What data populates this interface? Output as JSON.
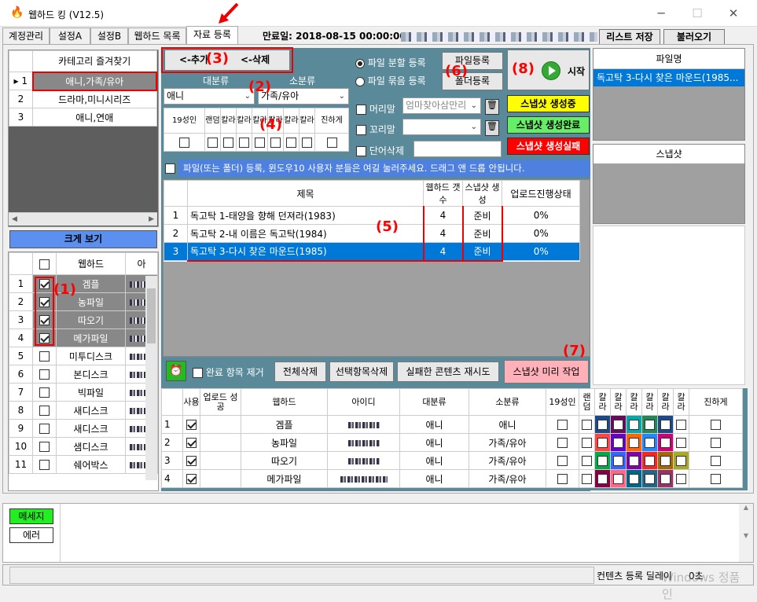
{
  "window": {
    "title": "웹하드 킹 (V12.5)",
    "minimize": "─",
    "maximize": "☐",
    "close": "✕"
  },
  "tabs": [
    "계정관리",
    "설정A",
    "설정B",
    "웹하드 목록",
    "자료 등록"
  ],
  "expiry": "만료일: 2018-08-15 00:00:00",
  "toolbar": {
    "save_list": "리스트 저장",
    "load": "불러오기"
  },
  "favorites": {
    "header": "카테고리 즐겨찾기",
    "rows": [
      {
        "n": "1",
        "v": "애니,가족/유아"
      },
      {
        "n": "2",
        "v": "드라마,미니시리즈"
      },
      {
        "n": "3",
        "v": "애니,연애"
      }
    ]
  },
  "big_view": "크게 보기",
  "webhard_list": {
    "header_name": "웹하드",
    "header_id": "아",
    "rows": [
      {
        "n": "1",
        "name": "겜플",
        "checked": true
      },
      {
        "n": "2",
        "name": "농파일",
        "checked": true
      },
      {
        "n": "3",
        "name": "따오기",
        "checked": true
      },
      {
        "n": "4",
        "name": "메가파일",
        "checked": true
      },
      {
        "n": "5",
        "name": "미투디스크",
        "checked": false
      },
      {
        "n": "6",
        "name": "본디스크",
        "checked": false
      },
      {
        "n": "7",
        "name": "빅파일",
        "checked": false
      },
      {
        "n": "8",
        "name": "새디스크",
        "checked": false
      },
      {
        "n": "9",
        "name": "새디스크",
        "checked": false
      },
      {
        "n": "10",
        "name": "샘디스크",
        "checked": false
      },
      {
        "n": "11",
        "name": "쉐어박스",
        "checked": false
      }
    ]
  },
  "category": {
    "add": "<-추가",
    "delete": "<-삭제",
    "major_label": "대분류",
    "minor_label": "소분류",
    "major_value": "애니",
    "minor_value": "가족/유아"
  },
  "flags": [
    "19성인",
    "랜덤",
    "칼라",
    "칼라",
    "칼라",
    "칼라",
    "칼라",
    "칼라",
    "진하게"
  ],
  "upload_mode": {
    "split": "파일 분할 등록",
    "bundle": "파일 묶음 등록",
    "file_reg": "파일등록",
    "folder_reg": "폴더등록"
  },
  "options": {
    "prefix": "머리말",
    "prefix_value": "엄마찾아삼만리",
    "suffix": "꼬리말",
    "word_del": "단어삭제"
  },
  "start": "시작",
  "snapshot_status": {
    "generating": "스냅샷 생성중",
    "done": "스냅샷 생성완료",
    "failed": "스냅샷 생성실패"
  },
  "file_panel": {
    "header": "파일명",
    "item": "독고탁 3-다시 찾은 마운드(1985...",
    "snapshot": "스냅샷"
  },
  "notice": "파일(또는 폴더) 등록, 윈도우10 사용자 분들은 여길 눌러주세요. 드래그 앤 드롭 안됩니다.",
  "content_table": {
    "headers": [
      "제목",
      "웹하드 갯수",
      "스냅샷 생성",
      "업로드진행상태"
    ],
    "rows": [
      {
        "n": "1",
        "title": "독고탁 1-태양을 향해 던져라(1983)",
        "count": "4",
        "snap": "준비",
        "progress": "0%"
      },
      {
        "n": "2",
        "title": "독고탁 2-내 이름은 독고탁(1984)",
        "count": "4",
        "snap": "준비",
        "progress": "0%"
      },
      {
        "n": "3",
        "title": "독고탁 3-다시 찾은 마운드(1985)",
        "count": "4",
        "snap": "준비",
        "progress": "0%"
      }
    ]
  },
  "actions": {
    "remove_done": "완료 항목 제거",
    "delete_all": "전체삭제",
    "delete_selected": "선택항목삭제",
    "retry_failed": "실패한 콘텐츠 재시도",
    "snapshot_pre": "스냅샷 미리 작업"
  },
  "bottom_table": {
    "headers": [
      "사용",
      "업로드 성공",
      "웹하드",
      "아이디",
      "대분류",
      "소분류",
      "19성인",
      "랜덤",
      "칼라",
      "칼라",
      "칼라",
      "칼라",
      "칼라",
      "칼라",
      "진하게"
    ],
    "rows": [
      {
        "n": "1",
        "name": "겜플",
        "major": "애니",
        "minor": "애니"
      },
      {
        "n": "2",
        "name": "농파일",
        "major": "애니",
        "minor": "가족/유아"
      },
      {
        "n": "3",
        "name": "따오기",
        "major": "애니",
        "minor": "가족/유아"
      },
      {
        "n": "4",
        "name": "메가파일",
        "major": "애니",
        "minor": "가족/유아"
      }
    ]
  },
  "messages": {
    "msg": "메세지",
    "err": "에러"
  },
  "statusbar": {
    "delay_label": "컨텐츠 등록 딜레이",
    "delay_value": "0초",
    "watermark": "Windows 정품 인"
  },
  "annotations": [
    "(1)",
    "(2)",
    "(3)",
    "(4)",
    "(5)",
    "(6)",
    "(7)",
    "(8)"
  ]
}
